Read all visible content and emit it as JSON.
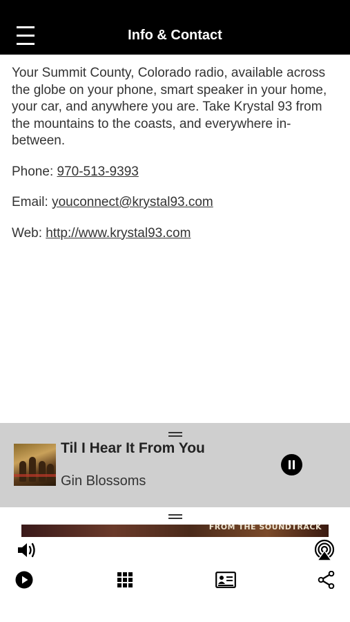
{
  "header": {
    "title": "Info & Contact",
    "menu_icon": "hamburger-menu-icon"
  },
  "info": {
    "description": "Your Summit County, Colorado radio, available across the globe on your phone, smart speaker in your home, your car, and anywhere you are. Take Krystal 93 from the mountains to the coasts, and everywhere in-between.",
    "phone_label": "Phone: ",
    "phone": "970-513-9393",
    "email_label": "Email: ",
    "email": "youconnect@krystal93.com",
    "web_label": "Web: ",
    "web": "http://www.krystal93.com"
  },
  "now_playing": {
    "title": "Til I Hear It From You",
    "artist": "Gin Blossoms",
    "state": "playing"
  },
  "banner": {
    "text": "FROM THE SOUNDTRACK"
  },
  "toolbar": {
    "icons": [
      "volume-icon",
      "airplay-icon",
      "play-icon",
      "grid-icon",
      "contact-card-icon",
      "share-icon"
    ]
  },
  "colors": {
    "header_bg": "#000000",
    "player_bg": "#cfcfcf",
    "text": "#333333"
  }
}
